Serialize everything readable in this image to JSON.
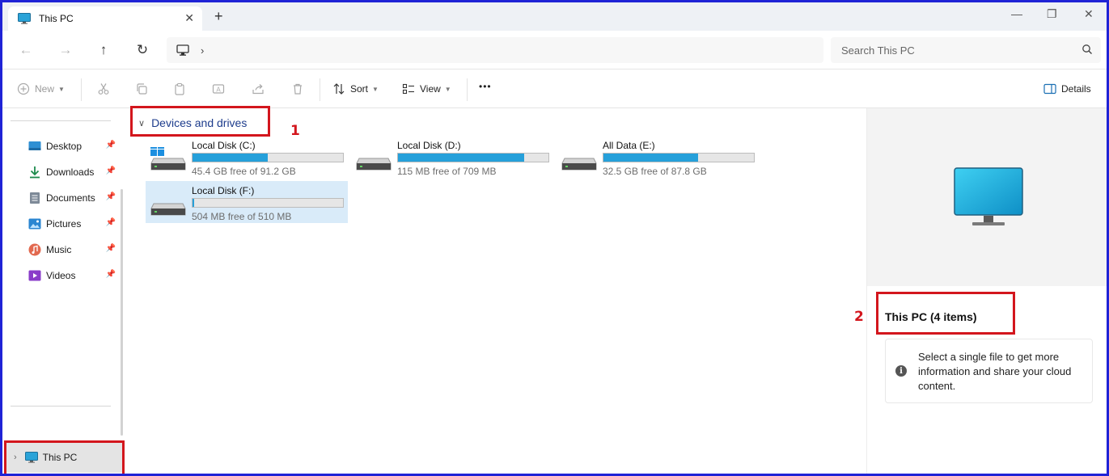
{
  "window": {
    "tab_title": "This PC",
    "tab_close": "✕",
    "new_tab": "+",
    "minimize": "—",
    "maximize": "❐",
    "close": "✕"
  },
  "nav": {
    "back": "←",
    "forward": "→",
    "up": "↑",
    "refresh": "↻",
    "breadcrumb_chevron": "›",
    "search_placeholder": "Search This PC"
  },
  "toolbar": {
    "new_label": "New",
    "sort_label": "Sort",
    "view_label": "View",
    "more_label": "•••",
    "details_label": "Details"
  },
  "sidebar": {
    "items": [
      {
        "label": "Desktop",
        "icon": "desktop-folder-icon"
      },
      {
        "label": "Downloads",
        "icon": "downloads-folder-icon"
      },
      {
        "label": "Documents",
        "icon": "documents-folder-icon"
      },
      {
        "label": "Pictures",
        "icon": "pictures-folder-icon"
      },
      {
        "label": "Music",
        "icon": "music-folder-icon"
      },
      {
        "label": "Videos",
        "icon": "videos-folder-icon"
      }
    ],
    "this_pc_label": "This PC"
  },
  "main": {
    "group_title": "Devices and drives",
    "drives": [
      {
        "name": "Local Disk (C:)",
        "free": "45.4 GB free of 91.2 GB",
        "used_fraction": 0.5,
        "system": true
      },
      {
        "name": "Local Disk (D:)",
        "free": "115 MB free of 709 MB",
        "used_fraction": 0.84,
        "system": false
      },
      {
        "name": "All Data (E:)",
        "free": "32.5 GB free of 87.8 GB",
        "used_fraction": 0.63,
        "system": false
      },
      {
        "name": "Local Disk (F:)",
        "free": "504 MB free of 510 MB",
        "used_fraction": 0.01,
        "system": false
      }
    ]
  },
  "details": {
    "title": "This PC (4 items)",
    "info_text": "Select a single file to get more information and share your cloud content."
  },
  "annotations": {
    "marker_1": "1",
    "marker_2": "2",
    "color": "#d3161d"
  },
  "colors": {
    "accent": "#26a0da",
    "selection": "#d9ebf9",
    "frame": "#1f23d6"
  }
}
